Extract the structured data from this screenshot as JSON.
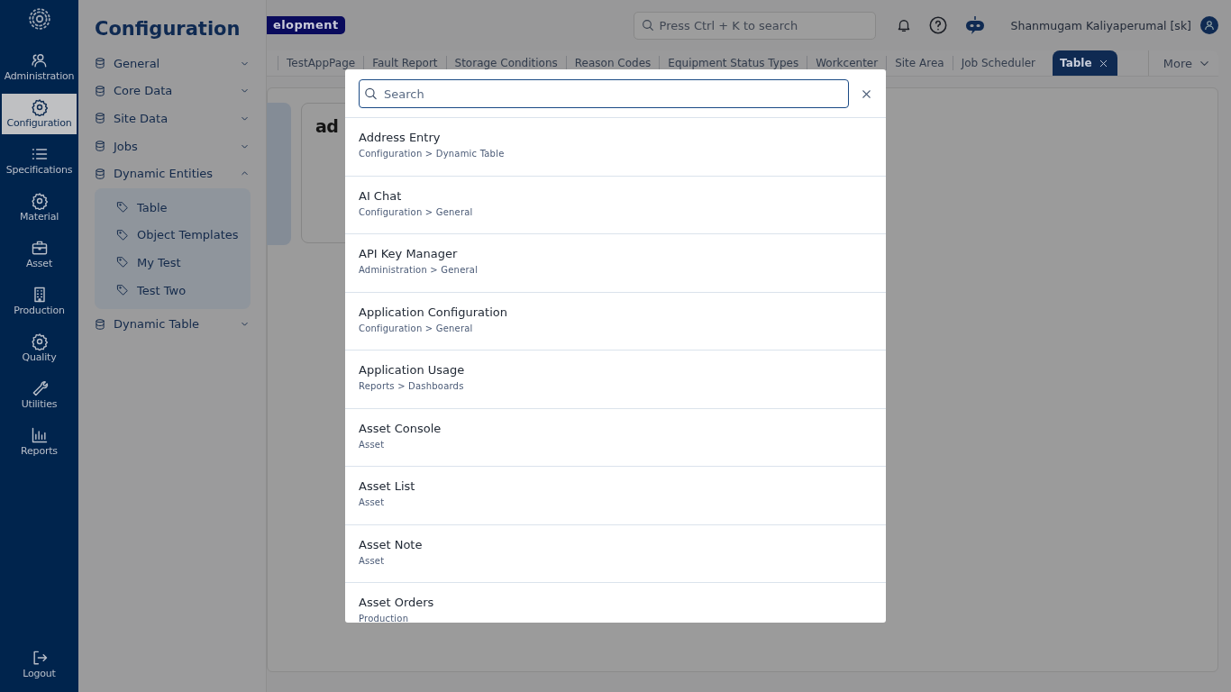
{
  "rail": {
    "items": [
      {
        "label": "Administration",
        "selected": false
      },
      {
        "label": "Configuration",
        "selected": true
      },
      {
        "label": "Specifications",
        "selected": false
      },
      {
        "label": "Material",
        "selected": false
      },
      {
        "label": "Asset",
        "selected": false
      },
      {
        "label": "Production",
        "selected": false
      },
      {
        "label": "Quality",
        "selected": false
      },
      {
        "label": "Utilities",
        "selected": false
      },
      {
        "label": "Reports",
        "selected": false
      }
    ],
    "logout": "Logout"
  },
  "sidebar": {
    "title": "Configuration",
    "items": [
      {
        "label": "General",
        "expanded": false
      },
      {
        "label": "Core Data",
        "expanded": false
      },
      {
        "label": "Site Data",
        "expanded": false
      },
      {
        "label": "Jobs",
        "expanded": false
      },
      {
        "label": "Dynamic Entities",
        "expanded": true,
        "children": [
          {
            "label": "Table"
          },
          {
            "label": "Object Templates"
          },
          {
            "label": "My Test"
          },
          {
            "label": "Test Two"
          }
        ]
      },
      {
        "label": "Dynamic Table",
        "expanded": false
      }
    ]
  },
  "header": {
    "environment_badge": "elopment",
    "search": {
      "placeholder": "Press Ctrl + K to search"
    },
    "user": "Shanmugam Kaliyaperumal [sk]"
  },
  "tabs": [
    {
      "label": "TestAppPage",
      "selected": false
    },
    {
      "label": "Fault Report",
      "selected": false
    },
    {
      "label": "Storage Conditions",
      "selected": false
    },
    {
      "label": "Reason Codes",
      "selected": false
    },
    {
      "label": "Equipment Status Types",
      "selected": false
    },
    {
      "label": "Workcenter",
      "selected": false
    },
    {
      "label": "Site Area",
      "selected": false
    },
    {
      "label": "Job Scheduler",
      "selected": false
    },
    {
      "label": "Table",
      "selected": true
    }
  ],
  "more": "More",
  "content": {
    "card_title": "ad"
  },
  "search_dialog": {
    "search": {
      "placeholder": "Search"
    },
    "results": [
      {
        "title": "Address Entry",
        "path": "Configuration > Dynamic Table"
      },
      {
        "title": "AI Chat",
        "path": "Configuration > General"
      },
      {
        "title": "API Key Manager",
        "path": "Administration > General"
      },
      {
        "title": "Application Configuration",
        "path": "Configuration > General"
      },
      {
        "title": "Application Usage",
        "path": "Reports > Dashboards"
      },
      {
        "title": "Asset Console",
        "path": "Asset"
      },
      {
        "title": "Asset List",
        "path": "Asset"
      },
      {
        "title": "Asset Note",
        "path": "Asset"
      },
      {
        "title": "Asset Orders",
        "path": "Production"
      }
    ]
  }
}
